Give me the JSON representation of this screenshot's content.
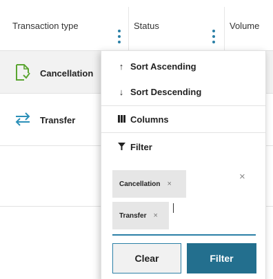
{
  "table": {
    "columns": [
      {
        "label": "Transaction type"
      },
      {
        "label": "Status"
      },
      {
        "label": "Volume"
      }
    ],
    "rows": [
      {
        "type": "Cancellation",
        "icon": "cancellation-doc-icon"
      },
      {
        "type": "Transfer",
        "icon": "transfer-arrows-icon"
      }
    ]
  },
  "menu": {
    "items": [
      {
        "icon": "↑",
        "label": "Sort Ascending"
      },
      {
        "icon": "↓",
        "label": "Sort Descending"
      },
      {
        "icon": "columns-icon",
        "label": "Columns"
      },
      {
        "icon": "filter-funnel-icon",
        "label": "Filter"
      }
    ],
    "chips": [
      {
        "label": "Cancellation",
        "remove": "×"
      },
      {
        "label": "Transfer",
        "remove": "×"
      }
    ],
    "clear_all_glyph": "×",
    "clear_button": "Clear",
    "filter_button": "Filter"
  },
  "colors": {
    "accent": "#2a7fa6",
    "primary_button": "#236f8e",
    "icon_green": "#5aa531",
    "icon_blue": "#2a8fb8"
  }
}
